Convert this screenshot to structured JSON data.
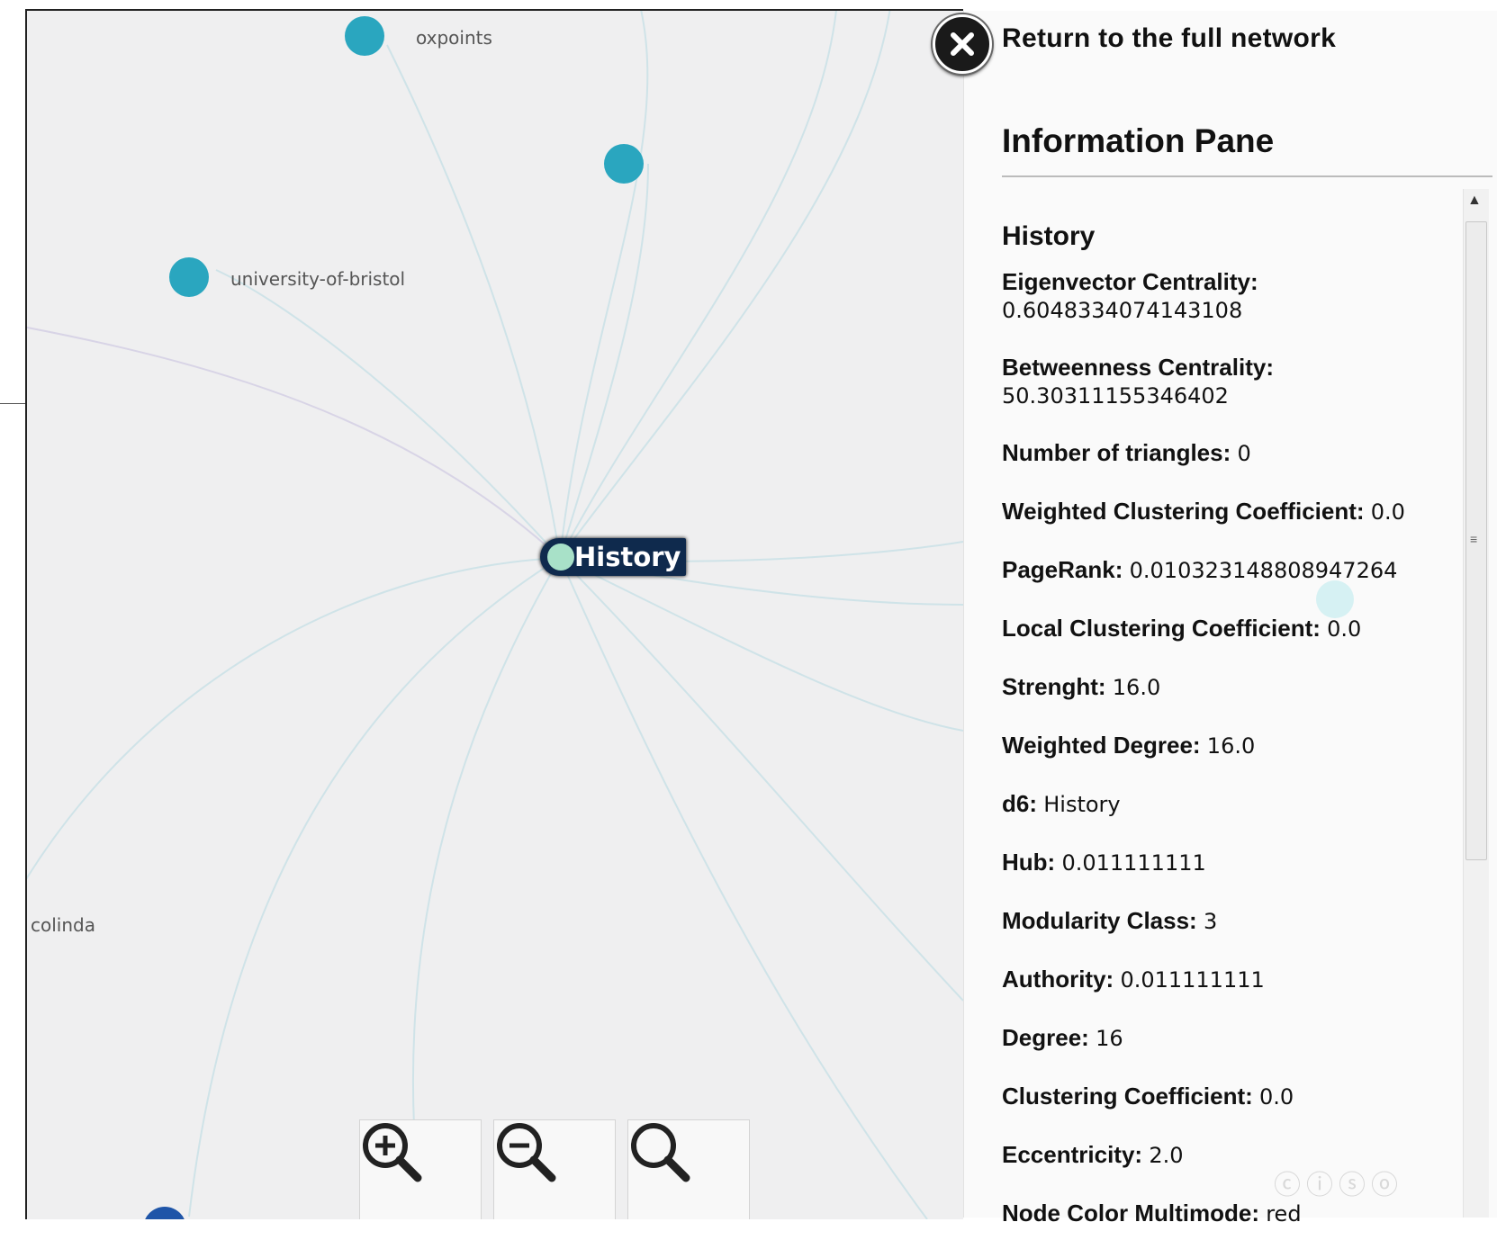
{
  "graph": {
    "nodes": [
      {
        "label": "oxpoints",
        "color": "#2aa6bf"
      },
      {
        "label": "",
        "color": "#2aa6bf"
      },
      {
        "label": "university-of-bristol",
        "color": "#2aa6bf"
      },
      {
        "label": "colinda",
        "color": "#2aa6bf"
      }
    ],
    "focus_node": "History",
    "focus_color": "#a8e1c8",
    "edge_color": "#cfe3e8",
    "zoom_controls": [
      "zoom-in-icon",
      "zoom-out-icon",
      "zoom-reset-icon"
    ]
  },
  "pane": {
    "return_label": "Return to the full network",
    "title": "Information Pane",
    "node_name": "History",
    "attributes": [
      {
        "key": "Eigenvector Centrality:",
        "value": "0.6048334074143108",
        "block": true
      },
      {
        "key": "Betweenness Centrality:",
        "value": "50.30311155346402",
        "block": true
      },
      {
        "key": "Number of triangles:",
        "value": "0"
      },
      {
        "key": "Weighted Clustering Coefficient:",
        "value": "0.0"
      },
      {
        "key": "PageRank:",
        "value": "0.010323148808947264"
      },
      {
        "key": "Local Clustering Coefficient:",
        "value": "0.0"
      },
      {
        "key": "Strenght:",
        "value": "16.0"
      },
      {
        "key": "Weighted Degree:",
        "value": "16.0"
      },
      {
        "key": "d6:",
        "value": "History"
      },
      {
        "key": "Hub:",
        "value": "0.011111111"
      },
      {
        "key": "Modularity Class:",
        "value": "3"
      },
      {
        "key": "Authority:",
        "value": "0.011111111"
      },
      {
        "key": "Degree:",
        "value": "16"
      },
      {
        "key": "Clustering Coefficient:",
        "value": "0.0"
      },
      {
        "key": "Eccentricity:",
        "value": "2.0"
      },
      {
        "key": "Node Color Multimode:",
        "value": "red"
      }
    ],
    "license_icon": "cc-by-nc-sa-icon"
  }
}
